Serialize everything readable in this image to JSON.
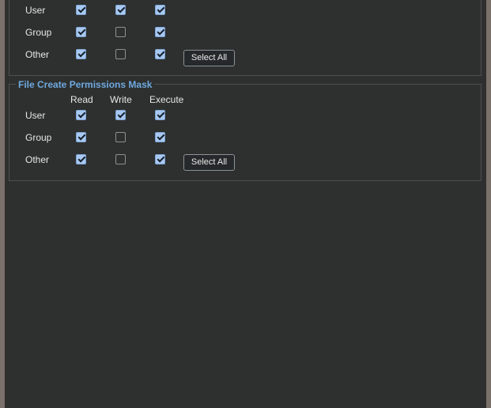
{
  "umask_section": {
    "rows": [
      {
        "label": "User",
        "read": true,
        "write": true,
        "execute": true
      },
      {
        "label": "Group",
        "read": true,
        "write": false,
        "execute": true
      },
      {
        "label": "Other",
        "read": true,
        "write": false,
        "execute": true
      }
    ],
    "select_all_label": "Select All"
  },
  "file_create_section": {
    "title": "File Create Permissions Mask",
    "columns": {
      "read": "Read",
      "write": "Write",
      "execute": "Execute"
    },
    "rows": [
      {
        "label": "User",
        "read": true,
        "write": true,
        "execute": true
      },
      {
        "label": "Group",
        "read": true,
        "write": false,
        "execute": true
      },
      {
        "label": "Other",
        "read": true,
        "write": false,
        "execute": true
      }
    ],
    "select_all_label": "Select All"
  },
  "colors": {
    "panel_background": "#2e302f",
    "window_frame": "#7a716b",
    "legend_text": "#6fa9e0",
    "checkbox_checked": "#a8c8f0"
  }
}
